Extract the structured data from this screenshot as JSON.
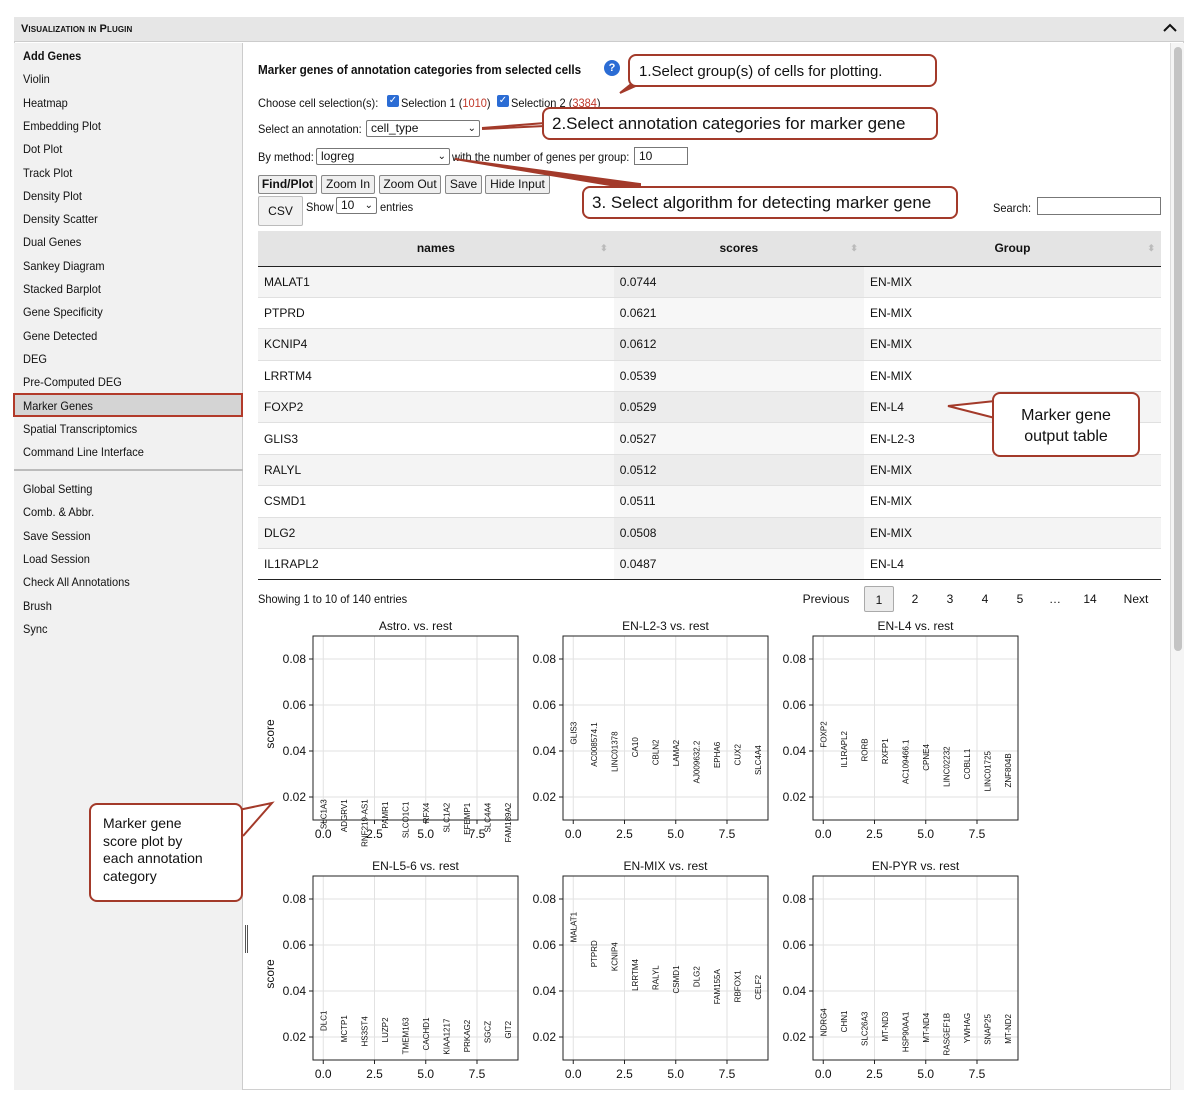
{
  "window": {
    "title": "Visualization in Plugin"
  },
  "sidebar": {
    "items": [
      "Add Genes",
      "Violin",
      "Heatmap",
      "Embedding Plot",
      "Dot Plot",
      "Track Plot",
      "Density Plot",
      "Density Scatter",
      "Dual Genes",
      "Sankey Diagram",
      "Stacked Barplot",
      "Gene Specificity",
      "Gene Detected",
      "DEG",
      "Pre-Computed DEG",
      "Marker Genes",
      "Spatial Transcriptomics",
      "Command Line Interface"
    ],
    "selected": "Marker Genes",
    "items2": [
      "Global Setting",
      "Comb. & Abbr.",
      "Save Session",
      "Load Session",
      "Check All Annotations",
      "Brush",
      "Sync"
    ]
  },
  "main": {
    "heading": "Marker genes of annotation categories from selected cells",
    "help_icon": "?",
    "choose_label": "Choose cell selection(s):",
    "selection1_label": "Selection 1 (",
    "selection1_count": "1010",
    "selection2_label": "Selection 2 (",
    "selection2_count": "3384",
    "paren_close": ")",
    "annotation_label": "Select an annotation:",
    "annotation_value": "cell_type",
    "method_label": "By method:",
    "method_value": "logreg",
    "genes_label": "with the number of genes per group:",
    "genes_value": "10",
    "buttons": {
      "find": "Find/Plot",
      "zoom_in": "Zoom In",
      "zoom_out": "Zoom Out",
      "save": "Save",
      "hide": "Hide Input",
      "csv": "CSV"
    },
    "show_label": "Show",
    "entries_value": "10",
    "entries_label": "entries",
    "search_label": "Search:",
    "table": {
      "headers": [
        "names",
        "scores",
        "Group"
      ],
      "rows": [
        [
          "MALAT1",
          "0.0744",
          "EN-MIX"
        ],
        [
          "PTPRD",
          "0.0621",
          "EN-MIX"
        ],
        [
          "KCNIP4",
          "0.0612",
          "EN-MIX"
        ],
        [
          "LRRTM4",
          "0.0539",
          "EN-MIX"
        ],
        [
          "FOXP2",
          "0.0529",
          "EN-L4"
        ],
        [
          "GLIS3",
          "0.0527",
          "EN-L2-3"
        ],
        [
          "RALYL",
          "0.0512",
          "EN-MIX"
        ],
        [
          "CSMD1",
          "0.0511",
          "EN-MIX"
        ],
        [
          "DLG2",
          "0.0508",
          "EN-MIX"
        ],
        [
          "IL1RAPL2",
          "0.0487",
          "EN-L4"
        ]
      ]
    },
    "table_info": "Showing 1 to 10 of 140 entries",
    "pagination": {
      "previous": "Previous",
      "pages": [
        "1",
        "2",
        "3",
        "4",
        "5",
        "…",
        "14"
      ],
      "next": "Next",
      "current": "1"
    }
  },
  "callouts": {
    "c1": "1.Select group(s) of cells for plotting.",
    "c2": "2.Select annotation categories for marker gene",
    "c3": "3. Select algorithm for detecting marker gene",
    "c4a": "Marker gene",
    "c4b": "output table",
    "c5a": "Marker gene",
    "c5b": "score plot by",
    "c5c": "each annotation",
    "c5d": "category"
  },
  "chart_data": [
    {
      "type": "scatter",
      "title": "Astro. vs. rest",
      "ylabel": "score",
      "xlim": [
        -0.5,
        9.5
      ],
      "ylim": [
        0.01,
        0.09
      ],
      "x_ticks": [
        "0.0",
        "2.5",
        "5.0",
        "7.5"
      ],
      "y_ticks": [
        "0.02",
        "0.04",
        "0.06",
        "0.08"
      ],
      "labels": [
        "SLC1A3",
        "ADGRV1",
        "RNF219-AS1",
        "PAMR1",
        "SLCO1C1",
        "RFX4",
        "SLC1A2",
        "EFEMP1",
        "SLC4A4",
        "FAM189A2"
      ],
      "values": [
        0.019,
        0.019,
        0.019,
        0.018,
        0.018,
        0.0175,
        0.0175,
        0.0175,
        0.0175,
        0.0175
      ]
    },
    {
      "type": "scatter",
      "title": "EN-L2-3 vs. rest",
      "ylabel": "",
      "xlim": [
        -0.5,
        9.5
      ],
      "ylim": [
        0.01,
        0.09
      ],
      "x_ticks": [
        "0.0",
        "2.5",
        "5.0",
        "7.5"
      ],
      "y_ticks": [
        "0.02",
        "0.04",
        "0.06",
        "0.08"
      ],
      "labels": [
        "GLIS3",
        "AC008574.1",
        "LINC01378",
        "CA10",
        "CBLN2",
        "LAMA2",
        "AJ009632.2",
        "EPHA6",
        "CUX2",
        "SLC4A4"
      ],
      "values": [
        0.0527,
        0.0525,
        0.0485,
        0.046,
        0.045,
        0.0448,
        0.0445,
        0.044,
        0.043,
        0.0425
      ]
    },
    {
      "type": "scatter",
      "title": "EN-L4 vs. rest",
      "ylabel": "",
      "xlim": [
        -0.5,
        9.5
      ],
      "ylim": [
        0.01,
        0.09
      ],
      "x_ticks": [
        "0.0",
        "2.5",
        "5.0",
        "7.5"
      ],
      "y_ticks": [
        "0.02",
        "0.04",
        "0.06",
        "0.08"
      ],
      "labels": [
        "FOXP2",
        "IL1RAPL2",
        "RORB",
        "RXFP1",
        "AC109466.1",
        "CPNE4",
        "LINC02232",
        "COBLL1",
        "LINC01725",
        "ZNF804B"
      ],
      "values": [
        0.0529,
        0.0487,
        0.0455,
        0.0455,
        0.045,
        0.043,
        0.042,
        0.041,
        0.04,
        0.039
      ]
    },
    {
      "type": "scatter",
      "title": "EN-L5-6 vs. rest",
      "ylabel": "score",
      "xlim": [
        -0.5,
        9.5
      ],
      "ylim": [
        0.01,
        0.09
      ],
      "x_ticks": [
        "0.0",
        "2.5",
        "5.0",
        "7.5"
      ],
      "y_ticks": [
        "0.02",
        "0.04",
        "0.06",
        "0.08"
      ],
      "labels": [
        "DLC1",
        "MCTP1",
        "HS3ST4",
        "LUZP2",
        "TMEM163",
        "CACHD1",
        "KIAA1217",
        "PRKAG2",
        "SGCZ",
        "GIT2"
      ],
      "values": [
        0.0315,
        0.0295,
        0.029,
        0.0285,
        0.0285,
        0.0285,
        0.028,
        0.0275,
        0.027,
        0.027
      ]
    },
    {
      "type": "scatter",
      "title": "EN-MIX vs. rest",
      "ylabel": "",
      "xlim": [
        -0.5,
        9.5
      ],
      "ylim": [
        0.01,
        0.09
      ],
      "x_ticks": [
        "0.0",
        "2.5",
        "5.0",
        "7.5"
      ],
      "y_ticks": [
        "0.02",
        "0.04",
        "0.06",
        "0.08"
      ],
      "labels": [
        "MALAT1",
        "PTPRD",
        "KCNIP4",
        "LRRTM4",
        "RALYL",
        "CSMD1",
        "DLG2",
        "FAM155A",
        "RBFOX1",
        "CELF2"
      ],
      "values": [
        0.0744,
        0.0621,
        0.0612,
        0.0539,
        0.0512,
        0.0511,
        0.0508,
        0.0495,
        0.049,
        0.047
      ]
    },
    {
      "type": "scatter",
      "title": "EN-PYR vs. rest",
      "ylabel": "",
      "xlim": [
        -0.5,
        9.5
      ],
      "ylim": [
        0.01,
        0.09
      ],
      "x_ticks": [
        "0.0",
        "2.5",
        "5.0",
        "7.5"
      ],
      "y_ticks": [
        "0.02",
        "0.04",
        "0.06",
        "0.08"
      ],
      "labels": [
        "NDRG4",
        "CHN1",
        "SLC26A3",
        "MT-ND3",
        "HSP90AA1",
        "MT-ND4",
        "RASGEF1B",
        "YWHAG",
        "SNAP25",
        "MT-ND2"
      ],
      "values": [
        0.0325,
        0.0315,
        0.031,
        0.031,
        0.031,
        0.0305,
        0.0305,
        0.0305,
        0.03,
        0.03
      ]
    }
  ]
}
